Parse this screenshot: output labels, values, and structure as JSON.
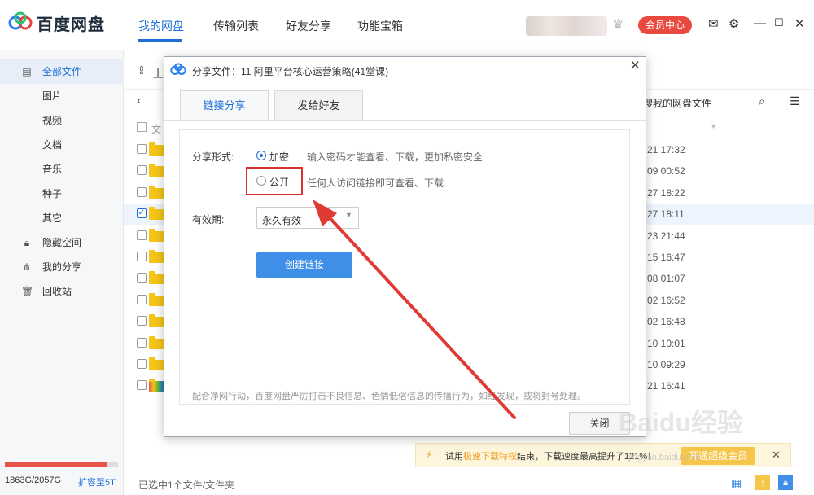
{
  "app": {
    "logo_text": "百度网盘",
    "nav_tabs": [
      {
        "label": "我的网盘"
      },
      {
        "label": "传输列表"
      },
      {
        "label": "好友分享"
      },
      {
        "label": "功能宝箱"
      }
    ],
    "vip_center": "会员中心"
  },
  "sidebar": {
    "items": [
      {
        "label": "全部文件",
        "icon": "file-icon"
      },
      {
        "label": "图片"
      },
      {
        "label": "视频"
      },
      {
        "label": "文档"
      },
      {
        "label": "音乐"
      },
      {
        "label": "种子"
      },
      {
        "label": "其它"
      },
      {
        "label": "隐藏空间",
        "icon": "lock-icon"
      },
      {
        "label": "我的分享",
        "icon": "share-icon"
      },
      {
        "label": "回收站",
        "icon": "trash-icon"
      }
    ],
    "quota_used": 1863,
    "quota_total": 2057,
    "quota_text": "1863G/2057G",
    "expand_link": "扩容至5T"
  },
  "toolbar": {
    "upload_label": "上",
    "search_partial": "搜我的网盘文件"
  },
  "file_list": {
    "header_partial": "文",
    "times": [
      "21 17:32",
      "09 00:52",
      "27 18:22",
      "27 18:11",
      "23 21:44",
      "15 16:47",
      "08 01:07",
      "02 16:52",
      "02 16:48",
      "10 10:01",
      "10 09:29",
      "21 16:41"
    ]
  },
  "status": {
    "selection": "已选中1个文件/文件夹"
  },
  "promo": {
    "text_before": "试用",
    "text_highlight": "极速下载特权",
    "text_after": "结束，下载速度最高提升了121%！",
    "button": "开通超级会员"
  },
  "dialog": {
    "title": "分享文件：11 阿里平台核心运营策略(41堂课)",
    "tabs": [
      {
        "label": "链接分享"
      },
      {
        "label": "发给好友"
      }
    ],
    "share_form_label": "分享形式:",
    "option_encrypted": "加密",
    "option_encrypted_hint": "输入密码才能查看、下载，更加私密安全",
    "option_public": "公开",
    "option_public_hint": "任何人访问链接即可查看、下载",
    "validity_label": "有效期:",
    "validity_value": "永久有效",
    "create_button": "创建链接",
    "notice": "配合净网行动，百度网盘严厉打击不良信息、色情低俗信息的传播行为，如经发现，或将封号处理。",
    "close_button": "关闭"
  },
  "watermark": {
    "text": "Baidu经验",
    "sub": "jingyan.baidu.com"
  },
  "colors": {
    "accent": "#1f6fd6",
    "vip": "#e94a3f",
    "highlight": "#d8322e",
    "button": "#3f8ee8"
  }
}
